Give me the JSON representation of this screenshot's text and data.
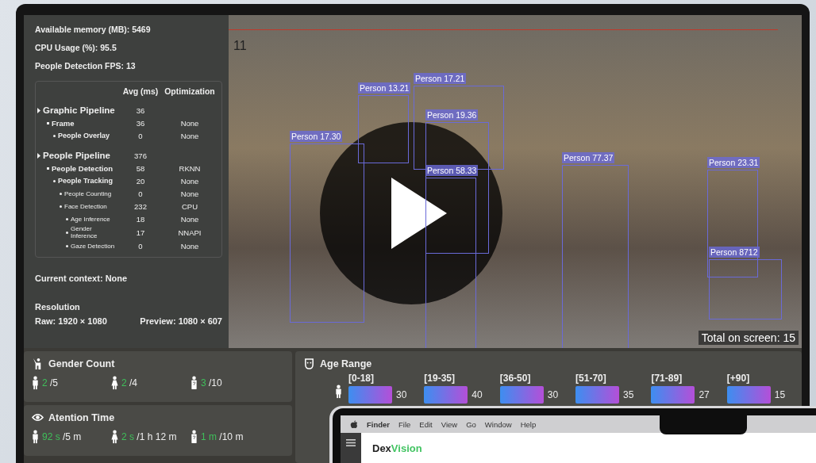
{
  "stats": [
    {
      "label": "Available memory (MB):",
      "value": "5469"
    },
    {
      "label": "CPU Usage (%):",
      "value": "95.5"
    },
    {
      "label": "People Detection FPS:",
      "value": "13"
    }
  ],
  "pipeline": {
    "columns": [
      "Avg (ms)",
      "Optimization"
    ],
    "rows": [
      {
        "name": "Graphic Pipeline",
        "avg": "36",
        "children": [
          {
            "name": "Frame",
            "avg": "36",
            "optimization": "None",
            "children": [
              {
                "name": "People Overlay",
                "avg": "0",
                "optimization": "None"
              }
            ]
          }
        ]
      },
      {
        "name": "People Pipeline",
        "avg": "376",
        "children": [
          {
            "name": "People Detection",
            "avg": "58",
            "optimization": "RKNN",
            "children": [
              {
                "name": "People Tracking",
                "avg": "20",
                "optimization": "None",
                "children": [
                  {
                    "name": "People Counting",
                    "avg": "0",
                    "optimization": "None"
                  },
                  {
                    "name": "Face Detection",
                    "avg": "232",
                    "optimization": "CPU",
                    "children": [
                      {
                        "name": "Age Inference",
                        "avg": "18",
                        "optimization": "None"
                      },
                      {
                        "name": "Gender Inference",
                        "avg": "17",
                        "optimization": "NNAPI"
                      },
                      {
                        "name": "Gaze Detection",
                        "avg": "0",
                        "optimization": "None"
                      }
                    ]
                  }
                ]
              }
            ]
          }
        ]
      }
    ]
  },
  "context": {
    "label": "Current context:",
    "value": "None"
  },
  "resolution": {
    "title": "Resolution",
    "raw_label": "Raw:",
    "raw": "1920 × 1080",
    "preview_label": "Preview:",
    "preview": "1080 × 607"
  },
  "video": {
    "frame_number": "11",
    "total": "Total on screen: 15",
    "detections": [
      "Person 13.21",
      "Person 17.21",
      "Person 19.36",
      "Person 17.30",
      "Person 58.33",
      "Person 77.37",
      "Person 23.31",
      "Person 8712"
    ]
  },
  "gender_count": {
    "title": "Gender Count",
    "items": [
      {
        "kind": "male",
        "value": "2",
        "total": "/5"
      },
      {
        "kind": "female",
        "value": "2",
        "total": "/4"
      },
      {
        "kind": "unknown",
        "value": "3",
        "total": "/10"
      }
    ]
  },
  "attention_time": {
    "title": "Atention Time",
    "items": [
      {
        "kind": "male",
        "value": "92 s",
        "total": "/5 m"
      },
      {
        "kind": "female",
        "value": "2 s",
        "total": "/1 h 12 m"
      },
      {
        "kind": "unknown",
        "value": "1 m",
        "total": "/10 m"
      }
    ]
  },
  "age_range": {
    "title": "Age Range",
    "bins": [
      {
        "label": "[0-18]",
        "value": "30"
      },
      {
        "label": "[19-35]",
        "value": "40"
      },
      {
        "label": "[36-50]",
        "value": "30"
      },
      {
        "label": "[51-70]",
        "value": "35"
      },
      {
        "label": "[71-89]",
        "value": "27"
      },
      {
        "label": "[+90]",
        "value": "15"
      }
    ]
  },
  "laptop": {
    "menu": [
      "Finder",
      "File",
      "Edit",
      "View",
      "Go",
      "Window",
      "Help"
    ],
    "logo_first": "Dex",
    "logo_second": "Vision"
  }
}
